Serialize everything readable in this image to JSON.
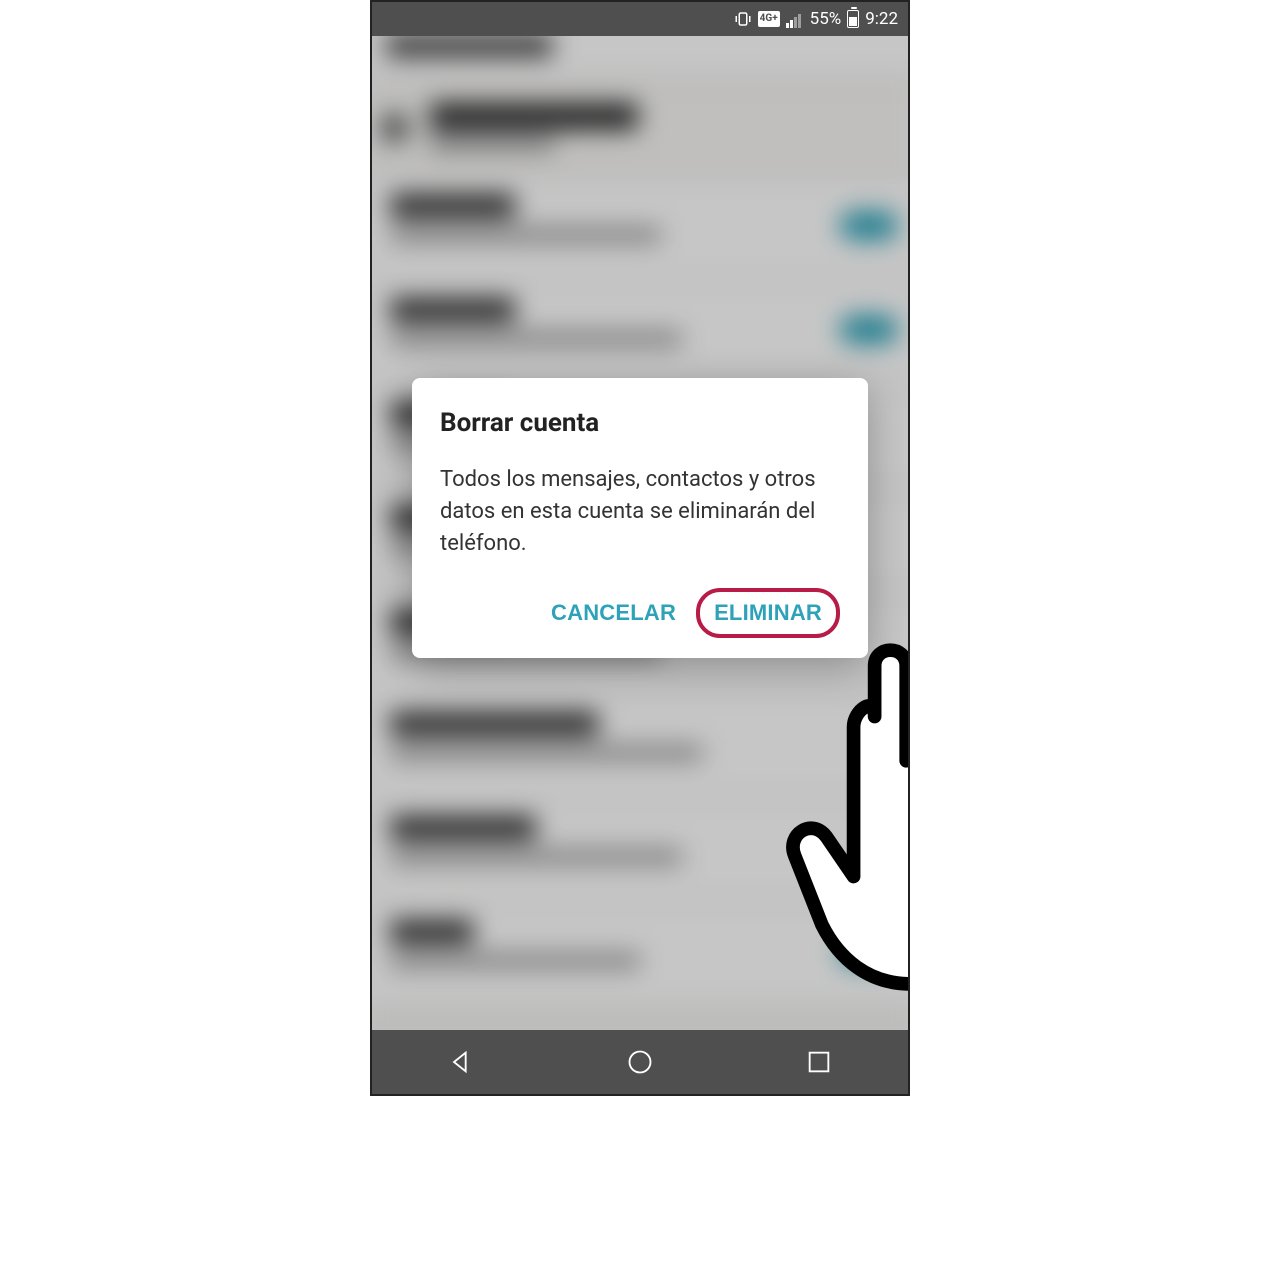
{
  "status_bar": {
    "network_badge": "4G+",
    "battery_text": "55%",
    "time": "9:22"
  },
  "dialog": {
    "title": "Borrar cuenta",
    "body": "Todos los mensajes, contactos y otros datos en esta cuenta se eliminarán del teléfono.",
    "cancel_label": "CANCELAR",
    "confirm_label": "ELIMINAR"
  }
}
